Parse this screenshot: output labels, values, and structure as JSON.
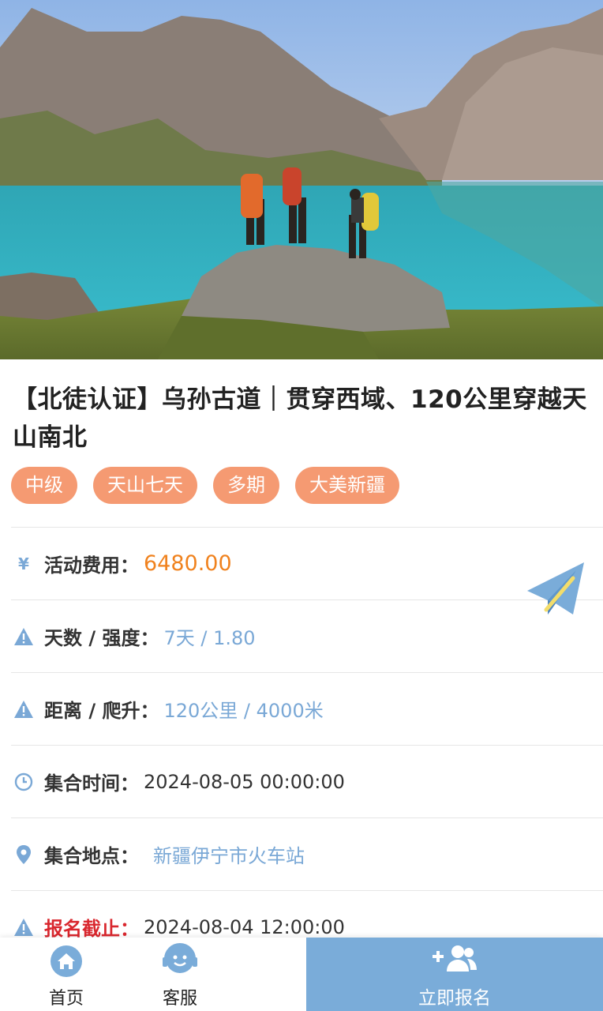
{
  "hero": {
    "image_name": "trekkers-on-rock-by-turquoise-lake"
  },
  "title": "【北徒认证】乌孙古道｜贯穿西域、120公里穿越天山南北",
  "tags": [
    "中级",
    "天山七天",
    "多期",
    "大美新疆"
  ],
  "info": {
    "fee": {
      "icon": "yen-icon",
      "label": "活动费用：",
      "value": "6480.00"
    },
    "days": {
      "icon": "warning-icon",
      "label": "天数 / 强度：",
      "value": "7天 / 1.80"
    },
    "distance": {
      "icon": "warning-icon",
      "label": "距离 / 爬升：",
      "value": "120公里 / 4000米"
    },
    "meet_time": {
      "icon": "clock-icon",
      "label": "集合时间：",
      "value": "2024-08-05 00:00:00"
    },
    "meet_place": {
      "icon": "location-pin-icon",
      "label": "集合地点：",
      "value": "新疆伊宁市火车站"
    },
    "deadline": {
      "icon": "warning-icon",
      "label": "报名截止：",
      "value": "2024-08-04 12:00:00"
    }
  },
  "share_icon": "paper-plane-icon",
  "bottom_nav": {
    "home": {
      "icon": "home-icon",
      "label": "首页"
    },
    "service": {
      "icon": "customer-service-icon",
      "label": "客服"
    },
    "signup": {
      "icon": "add-user-icon",
      "label": "立即报名"
    }
  },
  "colors": {
    "accent_blue": "#7aacd9",
    "tag_orange": "#f59a72",
    "price_orange": "#f0821e",
    "deadline_red": "#d9272e"
  }
}
